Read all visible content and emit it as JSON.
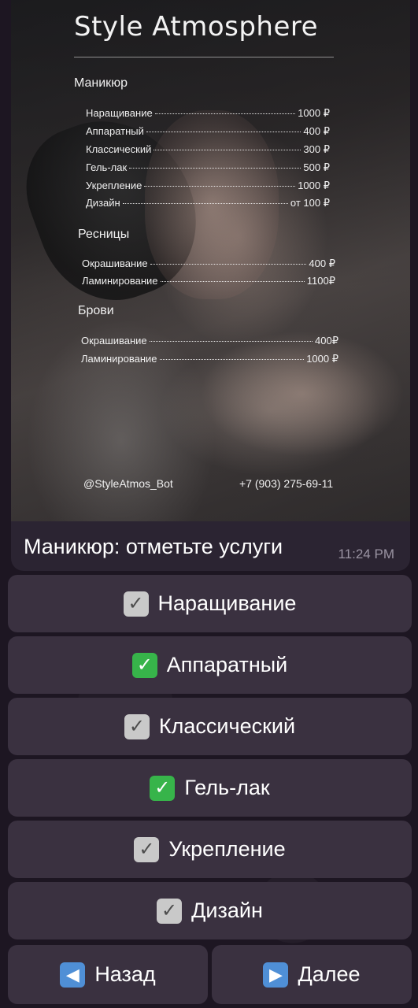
{
  "menu_card": {
    "title": "Style Atmosphere",
    "sections": [
      {
        "name": "Маникюр",
        "items": [
          {
            "name": "Наращивание",
            "price": "1000 ₽"
          },
          {
            "name": "Аппаратный",
            "price": "400 ₽"
          },
          {
            "name": "Классический",
            "price": "300 ₽"
          },
          {
            "name": "Гель-лак",
            "price": "500 ₽"
          },
          {
            "name": "Укрепление",
            "price": "1000 ₽"
          },
          {
            "name": "Дизайн",
            "price": "от 100 ₽"
          }
        ]
      },
      {
        "name": "Ресницы",
        "items": [
          {
            "name": "Окрашивание",
            "price": "400 ₽"
          },
          {
            "name": "Ламинирование",
            "price": "1100₽"
          }
        ]
      },
      {
        "name": "Брови",
        "items": [
          {
            "name": "Окрашивание",
            "price": "400₽"
          },
          {
            "name": "Ламинирование",
            "price": "1000 ₽"
          }
        ]
      }
    ],
    "footer_handle": "@StyleAtmos_Bot",
    "footer_phone": "+7 (903) 275-69-11"
  },
  "message": {
    "text": "Маникюр: отметьте услуги",
    "time": "11:24 PM"
  },
  "keyboard": {
    "buttons": [
      {
        "label": "Наращивание",
        "icon": "grey-check-icon"
      },
      {
        "label": "Аппаратный",
        "icon": "green-check-icon"
      },
      {
        "label": "Классический",
        "icon": "grey-check-icon"
      },
      {
        "label": "Гель-лак",
        "icon": "green-check-icon"
      },
      {
        "label": "Укрепление",
        "icon": "grey-check-icon"
      },
      {
        "label": "Дизайн",
        "icon": "grey-check-icon"
      }
    ],
    "back_label": "Назад",
    "back_icon": "left-arrow-icon",
    "next_label": "Далее",
    "next_icon": "right-arrow-icon"
  },
  "colors": {
    "button_bg": "#3a3140",
    "green_check": "#37b44a",
    "grey_check": "#c9c9c9",
    "arrow_blue": "#4f8fd6"
  }
}
